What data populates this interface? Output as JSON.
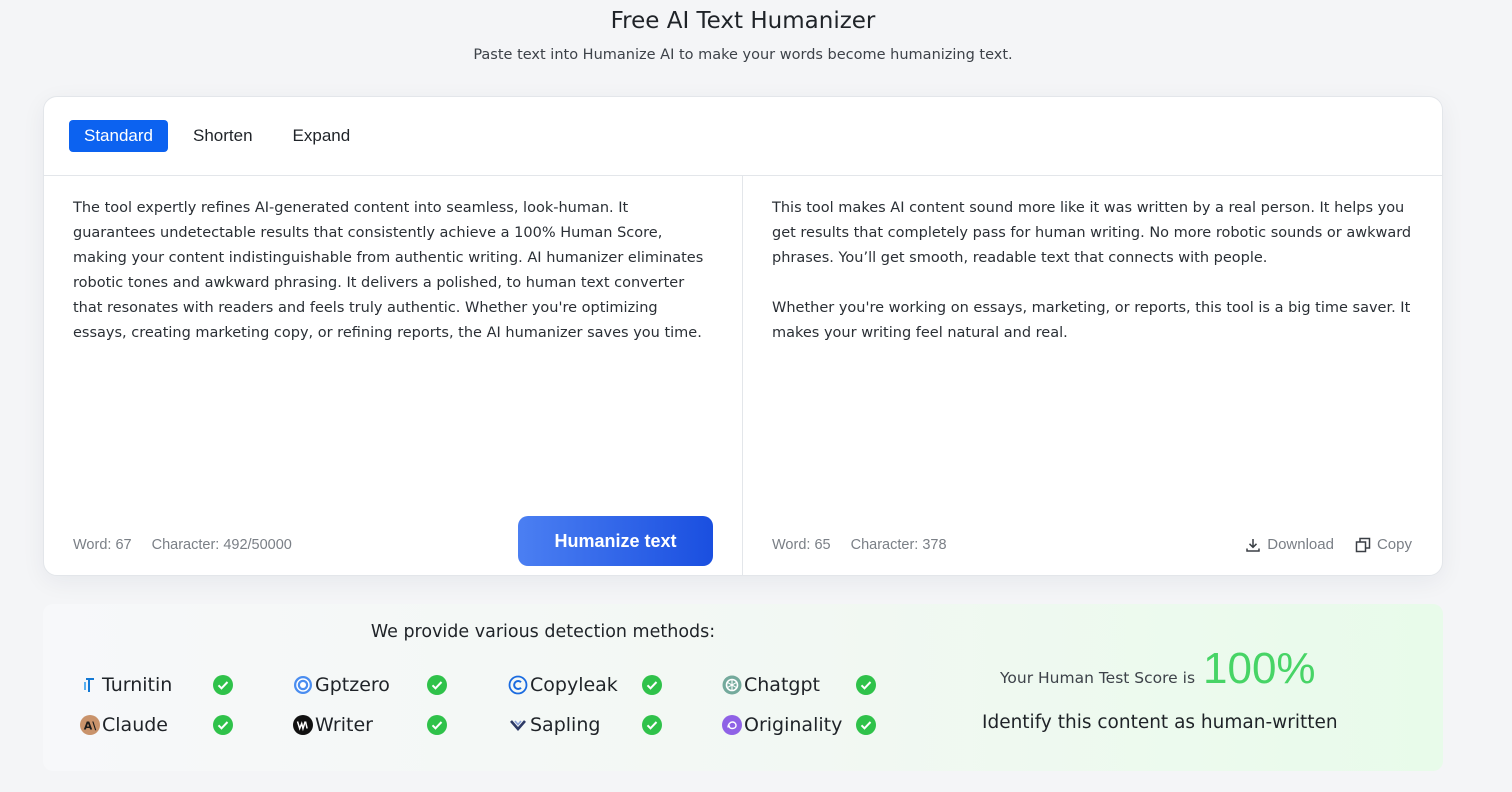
{
  "header": {
    "title": "Free AI Text Humanizer",
    "subtitle": "Paste text into Humanize AI to make your words become humanizing text."
  },
  "tabs": [
    {
      "label": "Standard",
      "active": true
    },
    {
      "label": "Shorten",
      "active": false
    },
    {
      "label": "Expand",
      "active": false
    }
  ],
  "input": {
    "text": "The tool expertly refines AI-generated content into seamless, look-human. It guarantees undetectable results that consistently achieve a 100% Human Score, making your content indistinguishable from authentic writing. AI humanizer eliminates robotic tones and awkward phrasing. It delivers a polished, to human text converter that resonates with readers and feels truly authentic. Whether you're optimizing essays, creating marketing copy, or refining reports, the AI humanizer saves you time.",
    "word_count": "Word: 67",
    "char_count": "Character: 492/50000",
    "button_label": "Humanize text"
  },
  "output": {
    "paragraphs": [
      "This tool makes AI content sound more like it was written by a real person. It helps you get results that completely pass for human writing. No more robotic sounds or awkward phrases. You’ll get smooth, readable text that connects with people.",
      "Whether you're working on essays, marketing, or reports, this tool is a big time saver. It makes your writing feel natural and real."
    ],
    "word_count": "Word: 65",
    "char_count": "Character: 378",
    "download_label": "Download",
    "copy_label": "Copy"
  },
  "detection": {
    "title": "We provide various detection methods:",
    "detectors": [
      {
        "name": "Turnitin",
        "icon": "turnitin-icon",
        "passed": true
      },
      {
        "name": "Gptzero",
        "icon": "gptzero-icon",
        "passed": true
      },
      {
        "name": "Copyleak",
        "icon": "copyleak-icon",
        "passed": true
      },
      {
        "name": "Chatgpt",
        "icon": "chatgpt-icon",
        "passed": true
      },
      {
        "name": "Claude",
        "icon": "claude-icon",
        "passed": true
      },
      {
        "name": "Writer",
        "icon": "writer-icon",
        "passed": true
      },
      {
        "name": "Sapling",
        "icon": "sapling-icon",
        "passed": true
      },
      {
        "name": "Originality",
        "icon": "originality-icon",
        "passed": true
      }
    ],
    "score_label": "Your Human Test Score is",
    "score_value": "100%",
    "verdict": "Identify this content as human-written"
  },
  "colors": {
    "accent": "#0c62f0",
    "check_green": "#2fc24a",
    "score_green": "#47d466"
  }
}
